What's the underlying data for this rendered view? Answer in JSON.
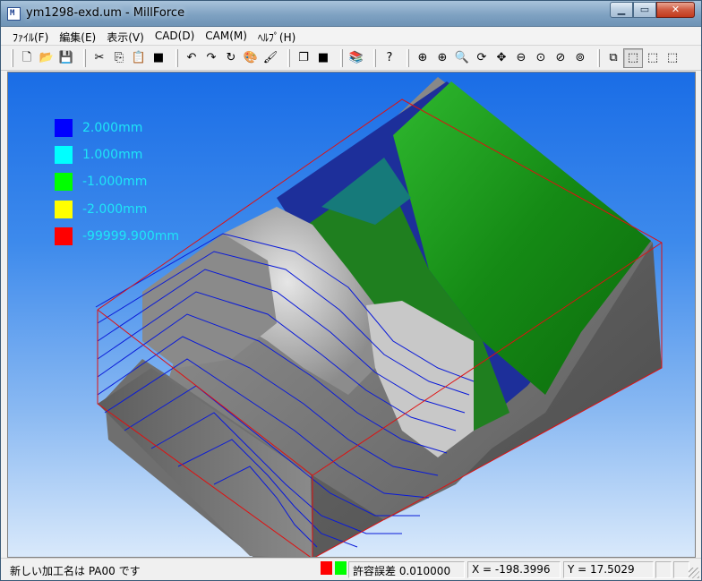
{
  "window": {
    "title": "ym1298-exd.um - MillForce",
    "app_icon": "M",
    "caption": {
      "minimize": "minimize-icon",
      "maximize": "maximize-icon",
      "close": "close-icon"
    }
  },
  "menu": [
    {
      "label": "ﾌｧｲﾙ(F)"
    },
    {
      "label": "編集(E)"
    },
    {
      "label": "表示(V)"
    },
    {
      "label": "CAD(D)"
    },
    {
      "label": "CAM(M)"
    },
    {
      "label": "ﾍﾙﾌﾟ(H)"
    }
  ],
  "toolbar": {
    "groups": [
      [
        {
          "icon": "new-file-icon",
          "glyph": "🗋"
        },
        {
          "icon": "open-folder-icon",
          "glyph": "📂"
        },
        {
          "icon": "save-icon",
          "glyph": "💾"
        }
      ],
      [
        {
          "icon": "cut-icon",
          "glyph": "✂"
        },
        {
          "icon": "copy-icon",
          "glyph": "⎘"
        },
        {
          "icon": "paste-icon",
          "glyph": "📋"
        },
        {
          "icon": "delete-icon",
          "glyph": "■"
        }
      ],
      [
        {
          "icon": "undo-icon",
          "glyph": "↶"
        },
        {
          "icon": "redo-icon",
          "glyph": "↷"
        },
        {
          "icon": "refresh-icon",
          "glyph": "↻"
        },
        {
          "icon": "palette-icon",
          "glyph": "🎨"
        },
        {
          "icon": "paint-icon",
          "glyph": "🖌"
        }
      ],
      [
        {
          "icon": "layers-icon",
          "glyph": "❐"
        },
        {
          "icon": "cube-blue-icon",
          "glyph": "■"
        }
      ],
      [
        {
          "icon": "books-icon",
          "glyph": "📚"
        }
      ],
      [
        {
          "icon": "help-icon",
          "glyph": "?"
        }
      ],
      [
        {
          "icon": "zoom-window-icon",
          "glyph": "⊕"
        },
        {
          "icon": "zoom-in-icon",
          "glyph": "⊕"
        },
        {
          "icon": "zoom-query-icon",
          "glyph": "🔍"
        },
        {
          "icon": "rotate-icon",
          "glyph": "⟳"
        },
        {
          "icon": "pan-icon",
          "glyph": "✥"
        },
        {
          "icon": "zoom-out-icon",
          "glyph": "⊖"
        },
        {
          "icon": "zoom-fit-icon",
          "glyph": "⊙"
        },
        {
          "icon": "zoom-prev-icon",
          "glyph": "⊘"
        },
        {
          "icon": "zoom-all-icon",
          "glyph": "⊚"
        }
      ],
      [
        {
          "icon": "view-wire-icon",
          "glyph": "⧉"
        },
        {
          "icon": "view-iso-icon",
          "glyph": "⬚",
          "pressed": true
        },
        {
          "icon": "view-cyan-icon",
          "glyph": "⬚"
        },
        {
          "icon": "view-shaded-icon",
          "glyph": "⬚"
        }
      ]
    ]
  },
  "legend": [
    {
      "color": "#0000ff",
      "label": "2.000mm"
    },
    {
      "color": "#00ffff",
      "label": "1.000mm"
    },
    {
      "color": "#00ff00",
      "label": "-1.000mm"
    },
    {
      "color": "#ffff00",
      "label": "-2.000mm"
    },
    {
      "color": "#ff0000",
      "label": "-99999.900mm"
    }
  ],
  "status": {
    "message": "新しい加工名は PA00 です",
    "tolerance_colors": [
      "#ff0000",
      "#00ff00"
    ],
    "tolerance": "許容誤差 0.010000",
    "x": "X = -198.3996",
    "y": "Y = 17.5029",
    "empty1": "",
    "empty2": ""
  }
}
